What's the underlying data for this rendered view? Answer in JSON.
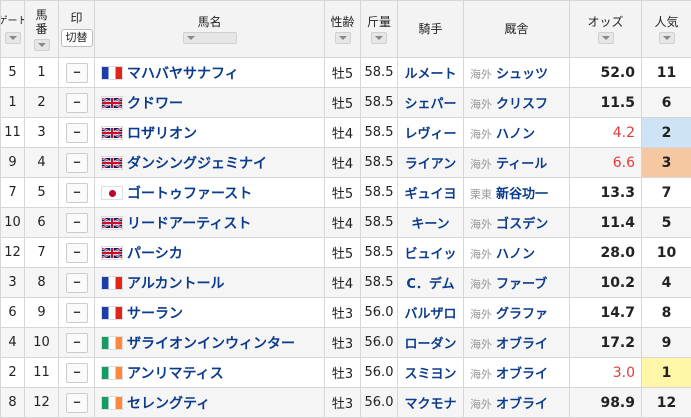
{
  "headers": {
    "gate": "ゲート",
    "num_a": "馬",
    "num_b": "番",
    "mark": "印",
    "mark_toggle": "切替",
    "name": "馬名",
    "sexage": "性齢",
    "weight": "斤量",
    "jockey": "騎手",
    "trainer": "厩舎",
    "odds": "オッズ",
    "popularity": "人気"
  },
  "mark_placeholder": "--",
  "rows": [
    {
      "gate": "5",
      "num": "1",
      "flag": "fr",
      "name": "マハバヤサナフィ",
      "sexage": "牡5",
      "weight": "58.5",
      "jockey": "ルメート",
      "region": "海外",
      "trainer": "シュッツ",
      "odds": "52.0",
      "pop": "11"
    },
    {
      "gate": "1",
      "num": "2",
      "flag": "gb",
      "name": "クドワー",
      "sexage": "牡5",
      "weight": "58.5",
      "jockey": "シェパー",
      "region": "海外",
      "trainer": "クリスフ",
      "odds": "11.5",
      "pop": "6"
    },
    {
      "gate": "11",
      "num": "3",
      "flag": "gb",
      "name": "ロザリオン",
      "sexage": "牡4",
      "weight": "58.5",
      "jockey": "レヴィー",
      "region": "海外",
      "trainer": "ハノン",
      "odds": "4.2",
      "pop": "2"
    },
    {
      "gate": "9",
      "num": "4",
      "flag": "gb",
      "name": "ダンシングジェミナイ",
      "sexage": "牡4",
      "weight": "58.5",
      "jockey": "ライアン",
      "region": "海外",
      "trainer": "ティール",
      "odds": "6.6",
      "pop": "3"
    },
    {
      "gate": "7",
      "num": "5",
      "flag": "jp",
      "name": "ゴートゥファースト",
      "sexage": "牡5",
      "weight": "58.5",
      "jockey": "ギュイヨ",
      "region": "栗東",
      "trainer": "新谷功一",
      "odds": "13.3",
      "pop": "7"
    },
    {
      "gate": "10",
      "num": "6",
      "flag": "gb",
      "name": "リードアーティスト",
      "sexage": "牡4",
      "weight": "58.5",
      "jockey": "キーン",
      "region": "海外",
      "trainer": "ゴスデン",
      "odds": "11.4",
      "pop": "5"
    },
    {
      "gate": "12",
      "num": "7",
      "flag": "gb",
      "name": "パーシカ",
      "sexage": "牡5",
      "weight": "58.5",
      "jockey": "ビュイッ",
      "region": "海外",
      "trainer": "ハノン",
      "odds": "28.0",
      "pop": "10"
    },
    {
      "gate": "3",
      "num": "8",
      "flag": "fr",
      "name": "アルカントール",
      "sexage": "牡4",
      "weight": "58.5",
      "jockey": "C．デム",
      "region": "海外",
      "trainer": "ファーブ",
      "odds": "10.2",
      "pop": "4"
    },
    {
      "gate": "6",
      "num": "9",
      "flag": "fr",
      "name": "サーラン",
      "sexage": "牡3",
      "weight": "56.0",
      "jockey": "バルザロ",
      "region": "海外",
      "trainer": "グラファ",
      "odds": "14.7",
      "pop": "8"
    },
    {
      "gate": "4",
      "num": "10",
      "flag": "ie",
      "name": "ザライオンインウィンター",
      "sexage": "牡3",
      "weight": "56.0",
      "jockey": "ローダン",
      "region": "海外",
      "trainer": "オブライ",
      "odds": "17.2",
      "pop": "9"
    },
    {
      "gate": "2",
      "num": "11",
      "flag": "ie",
      "name": "アンリマティス",
      "sexage": "牡3",
      "weight": "56.0",
      "jockey": "スミヨン",
      "region": "海外",
      "trainer": "オブライ",
      "odds": "3.0",
      "pop": "1"
    },
    {
      "gate": "8",
      "num": "12",
      "flag": "ie",
      "name": "セレングティ",
      "sexage": "牡3",
      "weight": "56.0",
      "jockey": "マクモナ",
      "region": "海外",
      "trainer": "オブライ",
      "odds": "98.9",
      "pop": "12"
    }
  ]
}
